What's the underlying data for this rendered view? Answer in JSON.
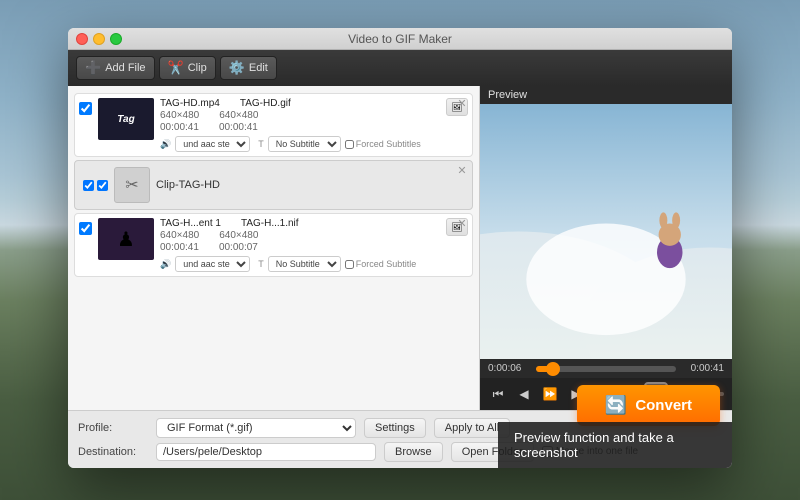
{
  "app": {
    "title": "Video to GIF Maker"
  },
  "window": {
    "traffic_lights": [
      "close",
      "minimize",
      "maximize"
    ]
  },
  "toolbar": {
    "add_file_label": "Add File",
    "clip_label": "Clip",
    "edit_label": "Edit"
  },
  "file_list": {
    "items": [
      {
        "id": "item1",
        "checked": true,
        "thumb_text": "Tag",
        "source_name": "TAG-HD.mp4",
        "source_res": "640×480",
        "source_duration": "00:00:41",
        "output_name": "TAG-HD.gif",
        "output_res": "640×480",
        "output_duration": "00:00:41",
        "audio_label": "und aac ste",
        "subtitle_label": "No Subtitle",
        "forced_subtitle": "Forced Subtitles"
      },
      {
        "id": "clip1",
        "type": "clip",
        "name": "Clip-TAG-HD"
      },
      {
        "id": "item2",
        "checked": true,
        "thumb_text": "♟",
        "source_name": "TAG-H...ent 1",
        "source_res": "640×480",
        "source_duration": "00:00:41",
        "output_name": "TAG-H...1.nif",
        "output_res": "640×480",
        "output_duration": "00:00:07",
        "audio_label": "und aac ste",
        "subtitle_label": "No Subtitle",
        "forced_subtitle": "Forced Subtitle"
      }
    ]
  },
  "preview": {
    "label": "Preview",
    "time_current": "0:00:06",
    "time_total": "0:00:41",
    "timeline_pct": 12
  },
  "transport": {
    "buttons": [
      "⏮",
      "◀",
      "⏩",
      "▶",
      "⏭",
      "⏹"
    ]
  },
  "bottom": {
    "profile_label": "Profile:",
    "profile_value": "GIF Format (*.gif)",
    "settings_label": "Settings",
    "apply_all_label": "Apply to All",
    "destination_label": "Destination:",
    "destination_value": "/Users/pele/Desktop",
    "browse_label": "Browse",
    "open_folder_label": "Open Folder",
    "merge_label": "Merge into one file"
  },
  "convert": {
    "label": "Convert"
  },
  "tooltip": {
    "text": "Preview function  and take a screenshot"
  }
}
